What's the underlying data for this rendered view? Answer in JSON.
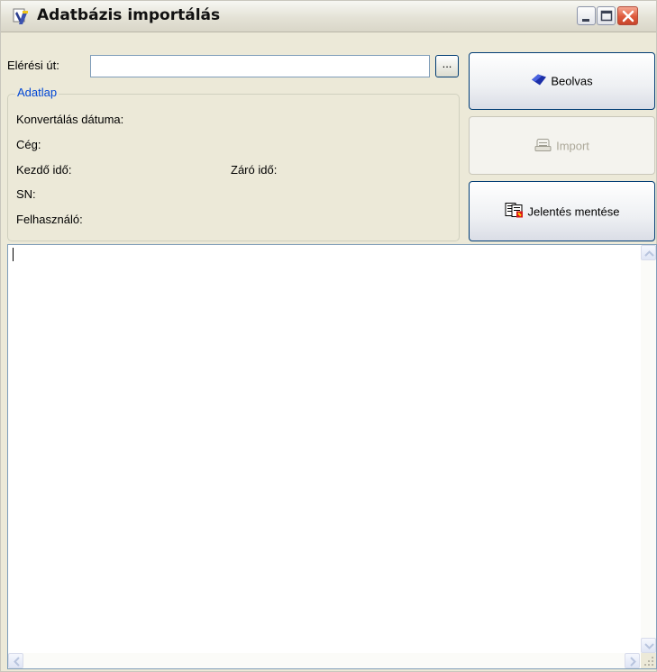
{
  "window": {
    "title": "Adatbázis importálás"
  },
  "path": {
    "label": "Elérési út:",
    "value": "",
    "browse_label": "..."
  },
  "group": {
    "legend": "Adatlap",
    "fields": {
      "conversion_date": "Konvertálás dátuma:",
      "company": "Cég:",
      "start_time": "Kezdő idő:",
      "end_time": "Záró idő:",
      "sn": "SN:",
      "user": "Felhasználó:"
    }
  },
  "buttons": {
    "read": {
      "label": "Beolvas",
      "icon": "blue-diamond-icon",
      "enabled": true
    },
    "import": {
      "label": "Import",
      "icon": "import-document-icon",
      "enabled": false
    },
    "save_report": {
      "label": "Jelentés mentése",
      "icon": "save-report-icon",
      "enabled": true
    }
  },
  "log": {
    "content": ""
  },
  "colors": {
    "group_legend": "#0046d5",
    "window_bg": "#ece9d8",
    "close_button": "#de5a3c",
    "disabled_text": "#aca899"
  }
}
